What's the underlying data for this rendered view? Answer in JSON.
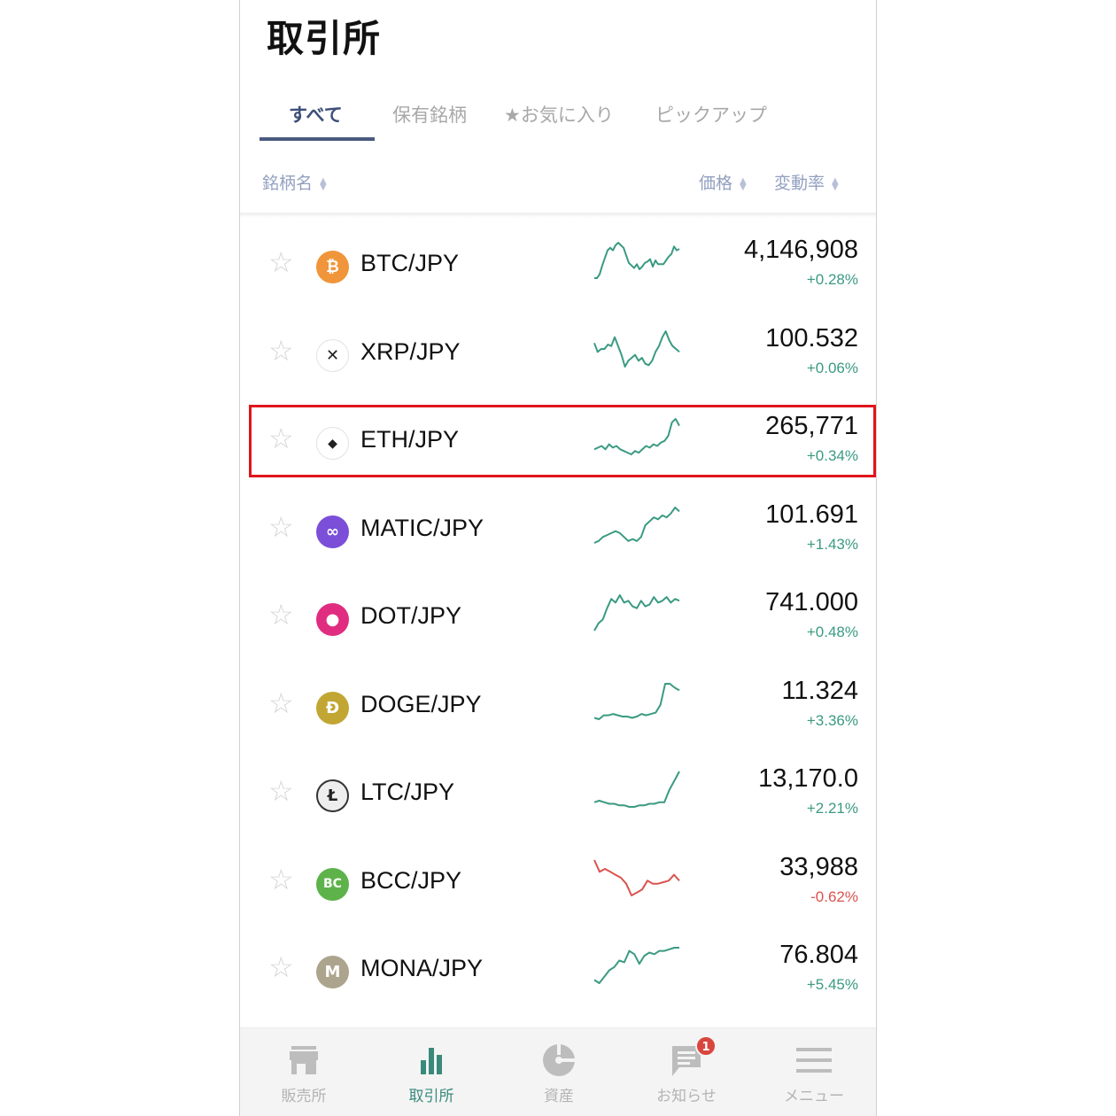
{
  "header": {
    "title": "取引所"
  },
  "tabs": [
    {
      "label": "すべて",
      "active": true
    },
    {
      "label": "保有銘柄",
      "active": false
    },
    {
      "label": "★お気に入り",
      "active": false
    },
    {
      "label": "ピックアップ",
      "active": false
    }
  ],
  "columns": {
    "name": "銘柄名",
    "price": "価格",
    "change": "変動率"
  },
  "colors": {
    "up": "#3a9a82",
    "down": "#d9534f",
    "active_tab": "#3d4f78",
    "highlight": "#e0141c",
    "nav_active": "#3a8a7c"
  },
  "coins": [
    {
      "pair": "BTC/JPY",
      "icon": "bitcoin-icon",
      "symbol": "₿",
      "icon_color": "#f0953a",
      "price": "4,146,908",
      "change": "+0.28%",
      "direction": "up",
      "highlighted": false,
      "sparkline": [
        2,
        2,
        5,
        12,
        18,
        24,
        26,
        24,
        28,
        30,
        28,
        26,
        20,
        14,
        12,
        10,
        13,
        9,
        11,
        14,
        15,
        17,
        11,
        16,
        13,
        13,
        13,
        16,
        19,
        21,
        27,
        24,
        25
      ]
    },
    {
      "pair": "XRP/JPY",
      "icon": "xrp-icon",
      "symbol": "✕",
      "icon_color": "#ffffff",
      "price": "100.532",
      "change": "+0.06%",
      "direction": "up",
      "highlighted": false,
      "sparkline": [
        20,
        14,
        16,
        16,
        19,
        18,
        24,
        18,
        12,
        4,
        8,
        10,
        12,
        8,
        10,
        6,
        5,
        8,
        14,
        18,
        24,
        28,
        22,
        18,
        16,
        14
      ]
    },
    {
      "pair": "ETH/JPY",
      "icon": "ethereum-icon",
      "symbol": "◆",
      "icon_color": "#ffffff",
      "price": "265,771",
      "change": "+0.34%",
      "direction": "up",
      "highlighted": true,
      "sparkline": [
        10,
        11,
        12,
        10,
        13,
        11,
        12,
        10,
        9,
        8,
        7,
        9,
        8,
        10,
        12,
        11,
        13,
        12,
        14,
        15,
        18,
        26,
        28,
        24
      ]
    },
    {
      "pair": "MATIC/JPY",
      "icon": "polygon-icon",
      "symbol": "∞",
      "icon_color": "#7b4fd8",
      "price": "101.691",
      "change": "+1.43%",
      "direction": "up",
      "highlighted": false,
      "sparkline": [
        6,
        7,
        9,
        10,
        11,
        12,
        11,
        9,
        7,
        8,
        7,
        9,
        15,
        17,
        19,
        18,
        20,
        19,
        21,
        24,
        22
      ]
    },
    {
      "pair": "DOT/JPY",
      "icon": "polkadot-icon",
      "symbol": "●",
      "icon_color": "#e02d80",
      "price": "741.000",
      "change": "+0.48%",
      "direction": "up",
      "highlighted": false,
      "sparkline": [
        4,
        8,
        10,
        16,
        21,
        19,
        23,
        19,
        20,
        17,
        16,
        20,
        17,
        18,
        22,
        19,
        20,
        22,
        19,
        21,
        20
      ]
    },
    {
      "pair": "DOGE/JPY",
      "icon": "dogecoin-icon",
      "symbol": "Ð",
      "icon_color": "#c2a633",
      "price": "11.324",
      "change": "+3.36%",
      "direction": "up",
      "highlighted": false,
      "sparkline": [
        4,
        3,
        6,
        6,
        7,
        6,
        5,
        5,
        4,
        5,
        7,
        6,
        7,
        8,
        14,
        30,
        30,
        27,
        25
      ]
    },
    {
      "pair": "LTC/JPY",
      "icon": "litecoin-icon",
      "symbol": "Ł",
      "icon_color": "#ffffff",
      "price": "13,170.0",
      "change": "+2.21%",
      "direction": "up",
      "highlighted": false,
      "sparkline": [
        8,
        9,
        8,
        7,
        7,
        6,
        6,
        5,
        5,
        6,
        6,
        7,
        7,
        8,
        8,
        16,
        22,
        28
      ]
    },
    {
      "pair": "BCC/JPY",
      "icon": "bitcoin-cash-icon",
      "symbol": "BC",
      "icon_color": "#5db34a",
      "price": "33,988",
      "change": "-0.62%",
      "direction": "down",
      "highlighted": false,
      "sparkline": [
        30,
        22,
        24,
        22,
        20,
        18,
        14,
        6,
        8,
        10,
        16,
        14,
        14,
        15,
        16,
        20,
        16
      ]
    },
    {
      "pair": "MONA/JPY",
      "icon": "monacoin-icon",
      "symbol": "M",
      "icon_color": "#aca48c",
      "price": "76.804",
      "change": "+5.45%",
      "direction": "up",
      "highlighted": false,
      "sparkline": [
        4,
        2,
        6,
        10,
        12,
        16,
        15,
        22,
        20,
        14,
        19,
        21,
        20,
        22,
        22,
        23,
        24,
        24
      ]
    }
  ],
  "bottom_nav": [
    {
      "label": "販売所",
      "icon": "store-icon",
      "active": false
    },
    {
      "label": "取引所",
      "icon": "bar-chart-icon",
      "active": true
    },
    {
      "label": "資産",
      "icon": "pie-chart-icon",
      "active": false
    },
    {
      "label": "お知らせ",
      "icon": "message-icon",
      "active": false,
      "badge": "1"
    },
    {
      "label": "メニュー",
      "icon": "menu-icon",
      "active": false
    }
  ]
}
